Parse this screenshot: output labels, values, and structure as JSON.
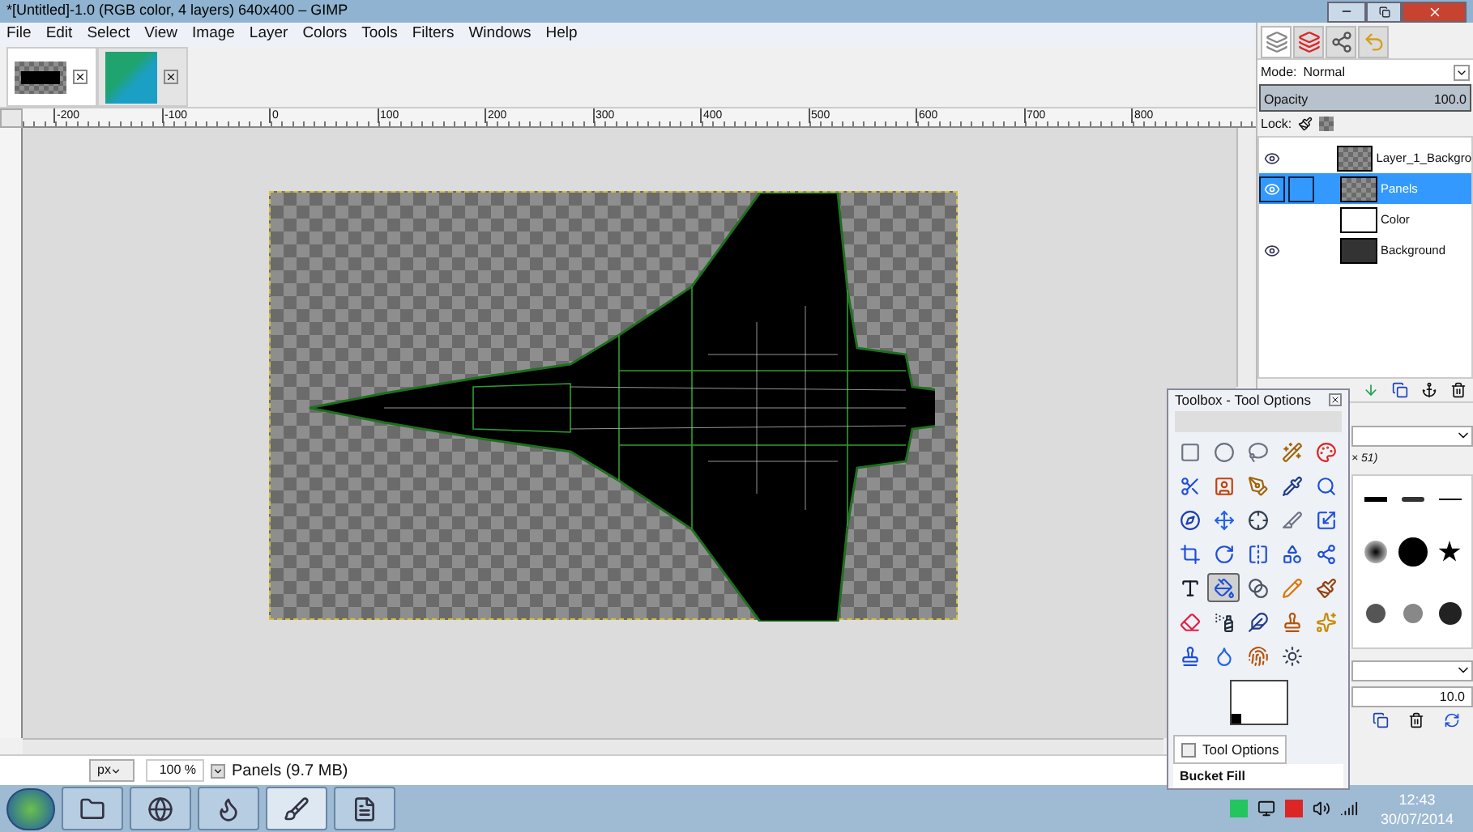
{
  "window": {
    "title": "*[Untitled]-1.0 (RGB color, 4 layers) 640x400 – GIMP"
  },
  "menu": [
    "File",
    "Edit",
    "Select",
    "View",
    "Image",
    "Layer",
    "Colors",
    "Tools",
    "Filters",
    "Windows",
    "Help"
  ],
  "image_tabs": [
    {
      "selected": true
    },
    {
      "selected": false
    }
  ],
  "ruler": [
    "-200",
    "-100",
    "0",
    "100",
    "200",
    "300",
    "400",
    "500",
    "600",
    "700",
    "800"
  ],
  "status_bar": {
    "unit": "px",
    "zoom": "100 %",
    "info": "Panels (9.7 MB)"
  },
  "layers_dock": {
    "tabs": [
      {
        "selected": true
      },
      {
        "selected": false
      },
      {
        "selected": false
      },
      {
        "selected": false
      }
    ],
    "mode_label": "Mode:",
    "mode": "Normal",
    "opacity_label": "Opacity",
    "opacity": "100.0",
    "level": 1,
    "lock_label": "Lock:",
    "layers": [
      {
        "name": "Layer_1_Backgro",
        "visible": true,
        "selected": false,
        "kind": "checker"
      },
      {
        "name": "Panels",
        "visible": true,
        "selected": true,
        "kind": "checker"
      },
      {
        "name": "Color",
        "visible": false,
        "selected": false,
        "kind": "white"
      },
      {
        "name": "Background",
        "visible": true,
        "selected": false,
        "kind": "dark"
      }
    ]
  },
  "toolbox": {
    "title": "Toolbox - Tool Options",
    "tools": [
      {
        "selected": false
      },
      {
        "selected": false
      },
      {
        "selected": false
      },
      {
        "selected": false
      },
      {
        "selected": false
      },
      {
        "selected": false
      },
      {
        "selected": false
      },
      {
        "selected": false
      },
      {
        "selected": false
      },
      {
        "selected": false
      },
      {
        "selected": false
      },
      {
        "selected": false
      },
      {
        "selected": false
      },
      {
        "selected": false
      },
      {
        "selected": false
      },
      {
        "selected": false
      },
      {
        "selected": false
      },
      {
        "selected": false
      },
      {
        "selected": false
      },
      {
        "selected": false
      },
      {
        "selected": false
      },
      {
        "selected": true
      },
      {
        "selected": false
      },
      {
        "selected": false
      },
      {
        "selected": false
      },
      {
        "selected": false
      },
      {
        "selected": false
      },
      {
        "selected": false
      },
      {
        "selected": false
      },
      {
        "selected": false
      },
      {
        "selected": false
      },
      {
        "selected": false
      },
      {
        "selected": false
      },
      {
        "selected": false
      }
    ],
    "tab": "Tool Options",
    "options_title": "Bucket Fill"
  },
  "brushes_dock": {
    "size_text": "× 51)",
    "spacing": "10.0"
  },
  "taskbar": {
    "apps": [
      {
        "selected": false
      },
      {
        "selected": false
      },
      {
        "selected": false
      },
      {
        "selected": true
      },
      {
        "selected": false
      }
    ],
    "time": "12:43",
    "date": "30/07/2014"
  }
}
